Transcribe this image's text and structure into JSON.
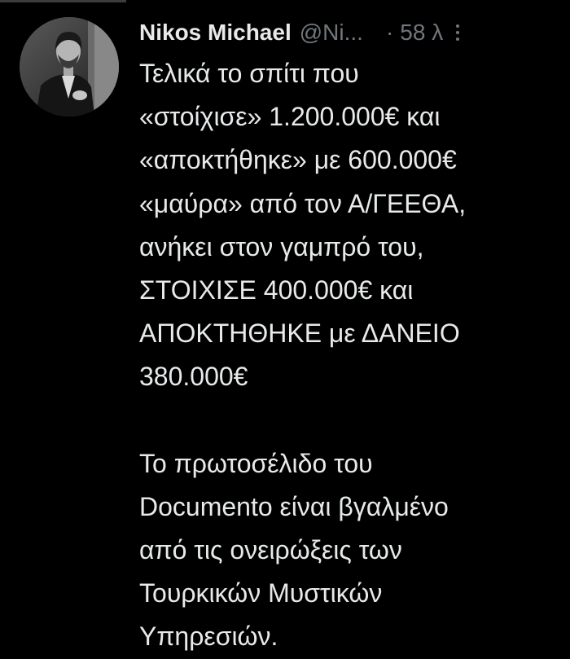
{
  "tweet": {
    "author": {
      "display_name": "Nikos Michael",
      "handle": "@Ni...",
      "avatar_icon": "profile-photo"
    },
    "separator": "·",
    "timestamp": "58 λ",
    "more_icon": "more-vertical-icon",
    "paragraph_1": [
      "Τελικά το σπίτι που",
      "«στοίχισε» 1.200.000€ και",
      "«αποκτήθηκε» με 600.000€",
      "«μαύρα» από τον Α/ΓΕΕΘΑ,",
      "ανήκει στον γαμπρό του,",
      "ΣΤΟΙΧΙΣΕ 400.000€ και",
      "ΑΠΟΚΤΗΘΗΚΕ με ΔΑΝΕΙΟ",
      "380.000€"
    ],
    "paragraph_2": [
      "Το πρωτοσέλιδο του",
      "Documento είναι βγαλμένο",
      "από τις ονειρώξεις των",
      "Τουρκικών Μυστικών",
      "Υπηρεσιών."
    ]
  },
  "colors": {
    "background": "#000000",
    "text_primary": "#e7e9ea",
    "text_secondary": "#71767b"
  }
}
